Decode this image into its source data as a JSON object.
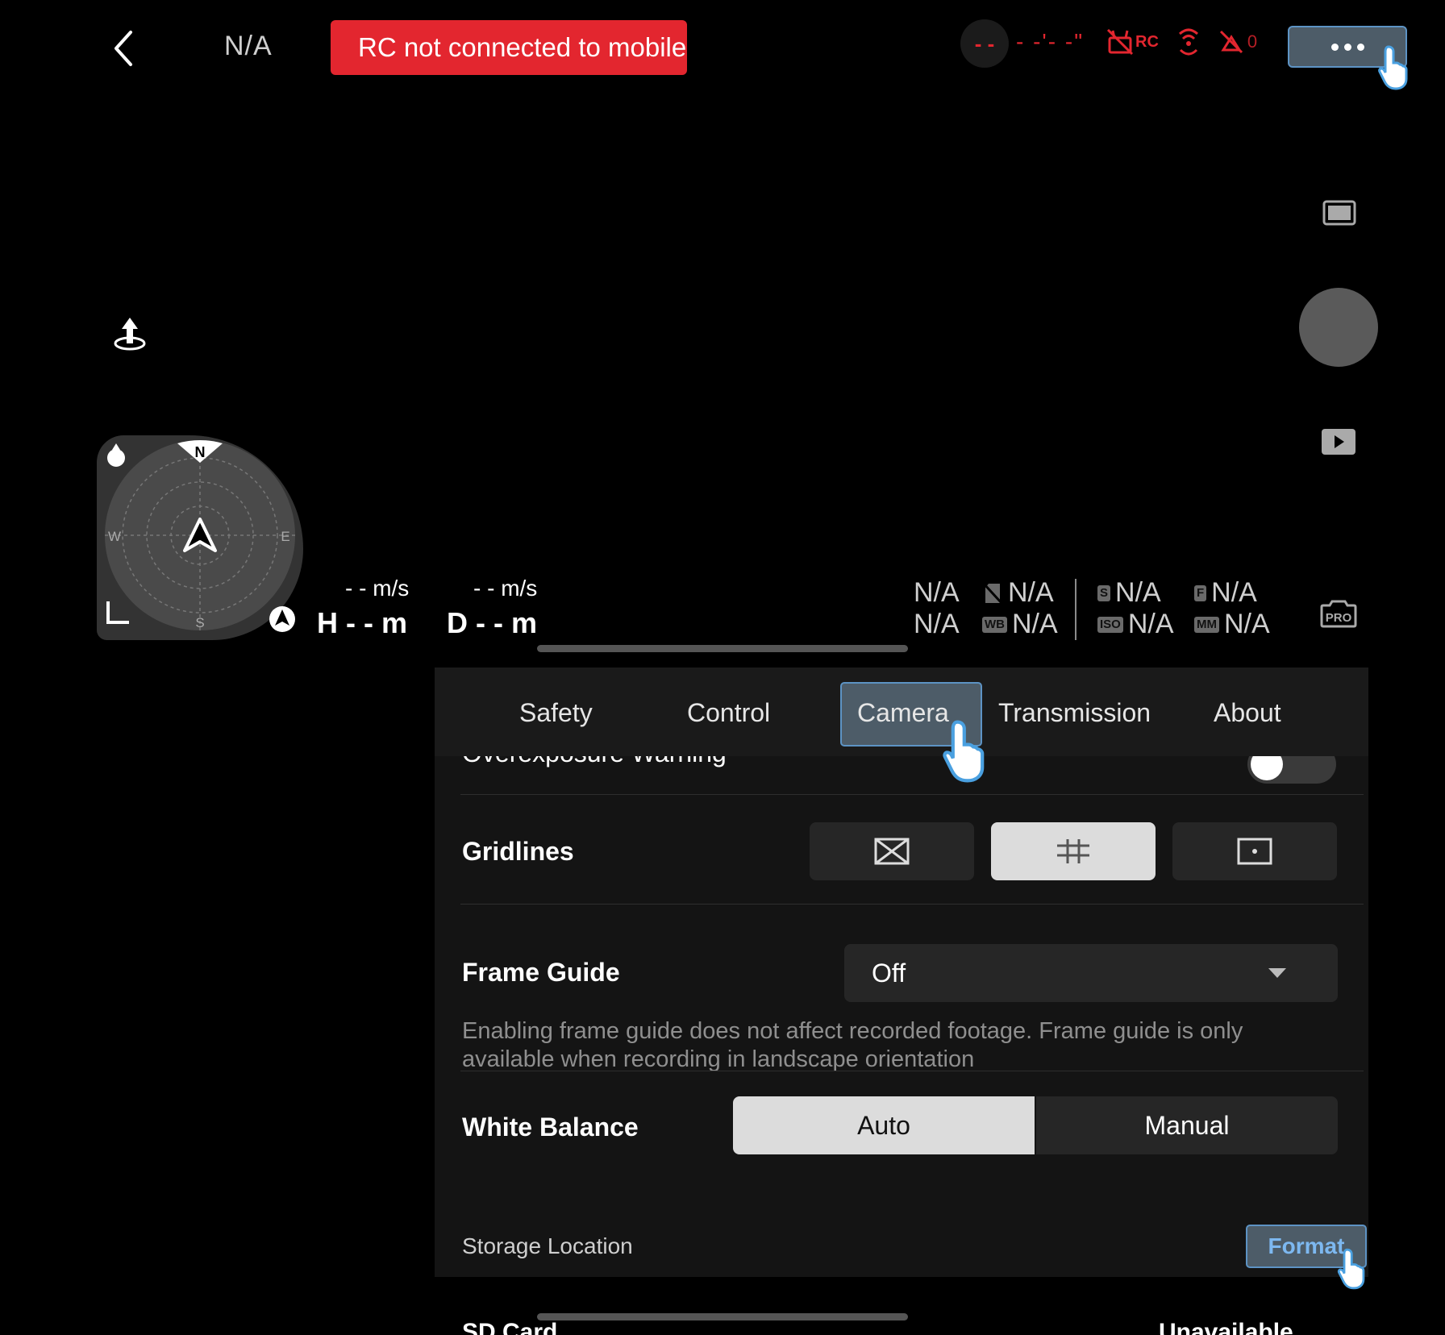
{
  "topbar": {
    "title": "N/A",
    "banner": "RC not connected to mobile device",
    "signal_label": "- -",
    "time_readout": "- -'- -\"",
    "rc_label": "RC",
    "vision_count": "0"
  },
  "telemetry": {
    "h_speed": "- - m/s",
    "v_speed": "- - m/s",
    "height": "H - - m",
    "distance": "D - - m"
  },
  "radar": {
    "north": "N",
    "south": "S",
    "west": "W",
    "east": "E"
  },
  "camera_params": {
    "p1": "N/A",
    "p2": "N/A",
    "p3": "N/A",
    "p4": "N/A",
    "p5": "N/A",
    "p6": "N/A",
    "p7": "N/A",
    "p8": "N/A",
    "badge_wb": "WB",
    "badge_s": "S",
    "badge_iso": "ISO",
    "badge_f": "F",
    "badge_mm": "MM",
    "pro_label": "PRO"
  },
  "settings": {
    "tabs": [
      "Safety",
      "Control",
      "Camera",
      "Transmission",
      "About"
    ],
    "active_tab": "Camera",
    "overexposure_label": "Overexposure Warning",
    "gridlines_label": "Gridlines",
    "frame_guide_label": "Frame Guide",
    "frame_guide_value": "Off",
    "frame_guide_hint": "Enabling frame guide does not affect recorded footage. Frame guide is only available when recording in landscape orientation",
    "white_balance_label": "White Balance",
    "wb_auto": "Auto",
    "wb_manual": "Manual",
    "storage_label": "Storage Location",
    "format_button": "Format",
    "sd_card_label": "SD Card",
    "sd_card_value": "Unavailable"
  },
  "colors": {
    "accent": "#5d93c4",
    "alert": "#e3262f",
    "panel": "#141414"
  }
}
